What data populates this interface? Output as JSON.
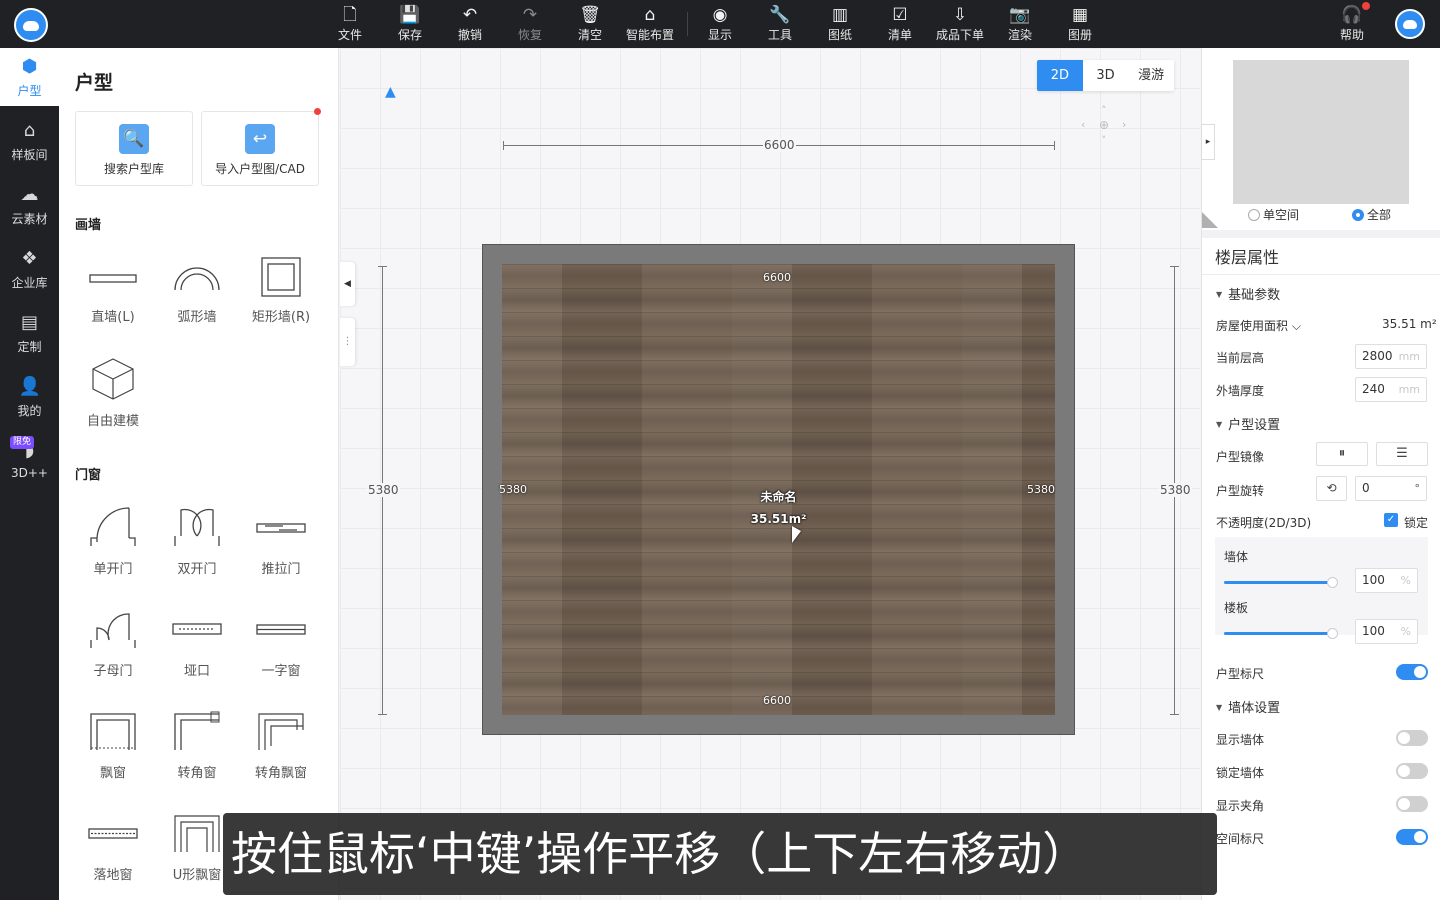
{
  "toolbar": {
    "items": [
      {
        "label": "文件",
        "icon": "file-icon",
        "glyph": "🗋"
      },
      {
        "label": "保存",
        "icon": "save-icon",
        "glyph": "💾"
      },
      {
        "label": "撤销",
        "icon": "undo-icon",
        "glyph": "↶"
      },
      {
        "label": "恢复",
        "icon": "redo-icon",
        "glyph": "↷"
      },
      {
        "label": "清空",
        "icon": "clear-icon",
        "glyph": "🗑"
      },
      {
        "label": "智能布置",
        "icon": "smart-layout-icon",
        "glyph": "⌂"
      },
      {
        "label": "显示",
        "icon": "eye-icon",
        "glyph": "◉"
      },
      {
        "label": "工具",
        "icon": "wrench-icon",
        "glyph": "🔧"
      },
      {
        "label": "图纸",
        "icon": "blueprint-icon",
        "glyph": "▥"
      },
      {
        "label": "清单",
        "icon": "checklist-icon",
        "glyph": "☑"
      },
      {
        "label": "成品下单",
        "icon": "order-icon",
        "glyph": "⇩"
      },
      {
        "label": "渲染",
        "icon": "camera-icon",
        "glyph": "📷"
      },
      {
        "label": "图册",
        "icon": "album-icon",
        "glyph": "▦"
      }
    ],
    "help_label": "帮助"
  },
  "leftnav": {
    "items": [
      {
        "label": "户型",
        "icon": "floorplan-cube-icon"
      },
      {
        "label": "样板间",
        "icon": "house-icon"
      },
      {
        "label": "云素材",
        "icon": "cloud-materials-icon"
      },
      {
        "label": "企业库",
        "icon": "enterprise-library-icon"
      },
      {
        "label": "定制",
        "icon": "custom-icon"
      },
      {
        "label": "我的",
        "icon": "user-icon"
      },
      {
        "label": "3D++",
        "icon": "3d-plus-icon",
        "badge": "限免"
      }
    ]
  },
  "lpanel": {
    "title": "户型",
    "cards": [
      {
        "label": "搜索户型库",
        "icon": "search-floorplan-icon"
      },
      {
        "label": "导入户型图/CAD",
        "icon": "import-cad-icon"
      }
    ],
    "wall_section": "画墙",
    "wall_tools": [
      "直墙(L)",
      "弧形墙",
      "矩形墙(R)",
      "自由建模"
    ],
    "door_section": "门窗",
    "door_tools": [
      "单开门",
      "双开门",
      "推拉门",
      "子母门",
      "垭口",
      "一字窗",
      "飘窗",
      "转角窗",
      "转角飘窗",
      "落地窗",
      "U形飘窗"
    ]
  },
  "canvas": {
    "view_modes": [
      "2D",
      "3D",
      "漫游"
    ],
    "active_view": "2D",
    "room_name": "未命名",
    "room_area": "35.51m²",
    "dim_width": "6600",
    "dim_height": "5380",
    "bottom_dim_partial": "6600"
  },
  "rpanel": {
    "radio_single": "单空间",
    "radio_all": "全部",
    "title": "楼层属性",
    "basic_group": "基础参数",
    "area_label": "房屋使用面积",
    "area_value": "35.51 m²",
    "height_label": "当前层高",
    "height_value": "2800",
    "thickness_label": "外墙厚度",
    "thickness_value": "240",
    "unit_mm": "mm",
    "layout_group": "户型设置",
    "mirror_label": "户型镜像",
    "rotate_label": "户型旋转",
    "rotate_value": "0",
    "rotate_unit": "°",
    "opacity_label": "不透明度(2D/3D)",
    "lock_label": "锁定",
    "wall_label": "墙体",
    "wall_opacity": "100",
    "floor_label": "楼板",
    "floor_opacity": "100",
    "percent": "%",
    "ruler_label": "户型标尺",
    "wall_group": "墙体设置",
    "show_wall": "显示墙体",
    "lock_wall": "锁定墙体",
    "show_angle": "显示夹角",
    "space_ruler": "空间标尺",
    "toggles": {
      "ruler": true,
      "show_wall": false,
      "lock_wall": false,
      "show_angle": false,
      "space_ruler": true
    },
    "opacity_fraction": {
      "wall": 1.0,
      "floor": 1.0
    }
  },
  "subtitle": "按住鼠标‘中键’操作平移（上下左右移动）",
  "colors": {
    "accent": "#2f8cf0",
    "topbar": "#202124",
    "alert": "#f04040"
  }
}
